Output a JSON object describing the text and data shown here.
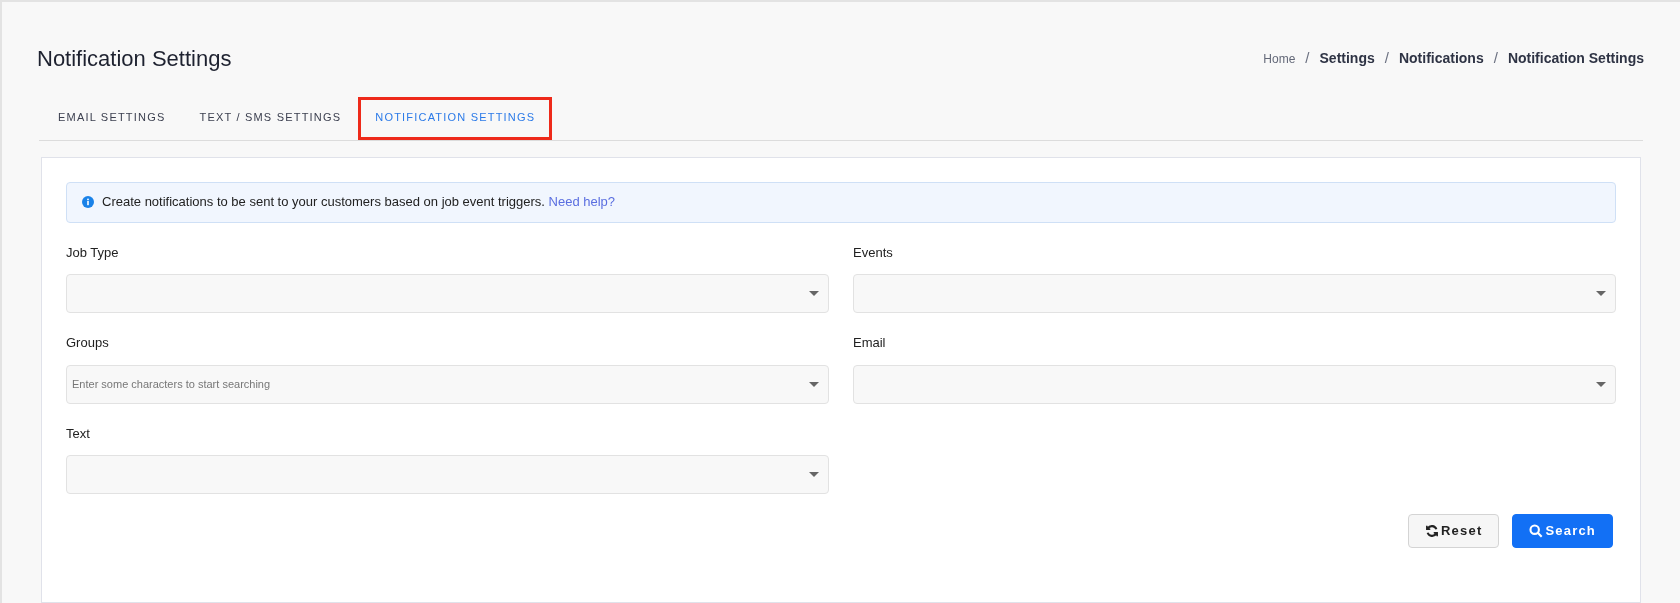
{
  "page": {
    "title": "Notification Settings"
  },
  "breadcrumb": [
    {
      "label": "Home",
      "current": false
    },
    {
      "label": "Settings",
      "current": true
    },
    {
      "label": "Notifications",
      "current": true
    },
    {
      "label": "Notification Settings",
      "current": true
    }
  ],
  "breadcrumb_separator": "/",
  "tabs": [
    {
      "label": "EMAIL SETTINGS",
      "selected": false,
      "highlighted": false
    },
    {
      "label": "TEXT / SMS SETTINGS",
      "selected": false,
      "highlighted": false
    },
    {
      "label": "NOTIFICATION SETTINGS",
      "selected": true,
      "highlighted": true
    }
  ],
  "alert": {
    "text": "Create notifications to be sent to your customers based on job event triggers.",
    "link": "Need help?"
  },
  "fields": [
    {
      "label": "Job Type"
    },
    {
      "label": "Events"
    },
    {
      "label": "Groups",
      "placeholder": "Enter some characters to start searching"
    },
    {
      "label": "Email"
    },
    {
      "label": "Text"
    }
  ],
  "buttons": [
    {
      "label": "Reset",
      "kind": "reset"
    },
    {
      "label": "Search",
      "kind": "search"
    }
  ]
}
